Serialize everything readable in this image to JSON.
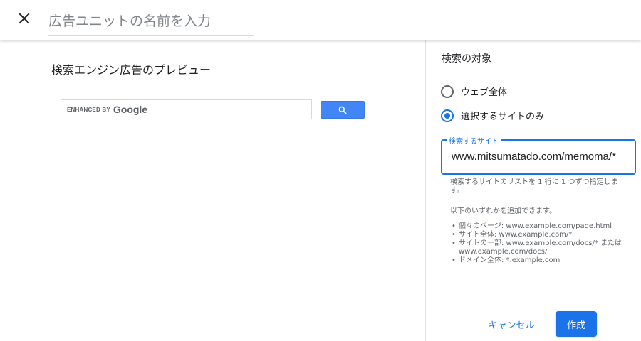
{
  "header": {
    "close_icon": "close-icon",
    "name_placeholder": "広告ユニットの名前を入力",
    "name_value": ""
  },
  "preview": {
    "title": "検索エンジン広告のプレビュー",
    "box_enhanced": "ENHANCED BY",
    "box_google": "Google",
    "search_icon": "search-icon",
    "search_button_color": "#4285f4"
  },
  "sidebar": {
    "title": "検索の対象",
    "options": [
      {
        "label": "ウェブ全体",
        "selected": false
      },
      {
        "label": "選択するサイトのみ",
        "selected": true
      }
    ],
    "sites_field": {
      "label": "検索するサイト",
      "value": "www.mitsumatado.com/memoma/*"
    },
    "help_text": "検索するサイトのリストを 1 行に 1 つずつ指定します。",
    "add_text": "以下のいずれかを追加できます。",
    "examples": [
      "個々のページ: www.example.com/page.html",
      "サイト全体: www.example.com/*",
      "サイトの一部: www.example.com/docs/* または www.example.com/docs/",
      "ドメイン全体: *.example.com"
    ],
    "cancel_label": "キャンセル",
    "create_label": "作成",
    "accent_color": "#1a73e8"
  }
}
